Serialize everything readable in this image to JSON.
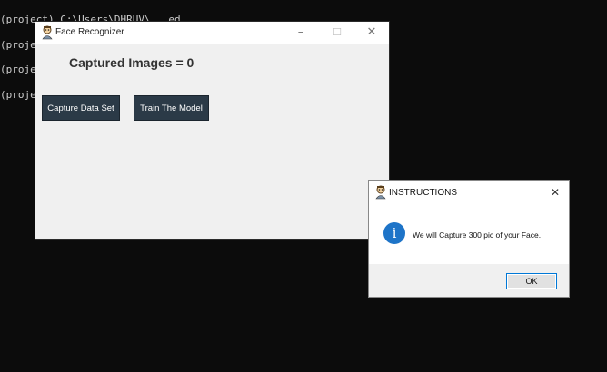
{
  "console": {
    "lines": [
      "(project) C:\\Users\\DHRUV\\...ed",
      "(project",
      "(project",
      "(project"
    ]
  },
  "main_window": {
    "title": "Face Recognizer",
    "captured_label": "Captured Images = 0",
    "buttons": {
      "capture": "Capture Data Set",
      "train": "Train The Model"
    },
    "controls": {
      "minimize": "–",
      "maximize": "☐",
      "close": "✕"
    }
  },
  "dialog": {
    "title": "INSTRUCTIONS",
    "message": "We will Capture 300 pic of your Face.",
    "ok_label": "OK",
    "close": "✕",
    "info_glyph": "i"
  },
  "colors": {
    "console_bg": "#0c0c0c",
    "button_bg": "#2b3a47",
    "info_blue": "#1e74c8",
    "ok_border": "#0078d7"
  }
}
